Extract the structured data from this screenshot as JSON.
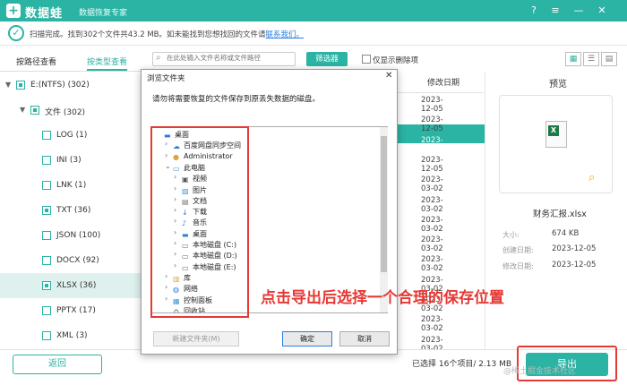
{
  "titlebar": {
    "logo_glyph": "+",
    "app_name": "数据蛙",
    "subtitle": "数据恢复专家",
    "icons": [
      "question-icon",
      "settings-icon",
      "minimize-icon",
      "close-icon"
    ]
  },
  "status": {
    "message": "扫描完成。找到302个文件共43.2 MB。如未能找到您想找回的文件请",
    "link": "联系我们。"
  },
  "tabs": {
    "by_path": "按路径查看",
    "by_type": "按类型查看"
  },
  "tree": [
    {
      "label": "E:(NTFS) (302)",
      "arrow": "▼",
      "state": "partial",
      "level": 0
    },
    {
      "label": "文件 (302)",
      "arrow": "▼",
      "state": "partial",
      "level": 1
    },
    {
      "label": "LOG (1)",
      "state": "empty",
      "level": 2
    },
    {
      "label": "INI (3)",
      "state": "empty",
      "level": 2
    },
    {
      "label": "LNK (1)",
      "state": "empty",
      "level": 2
    },
    {
      "label": "TXT (36)",
      "state": "partial",
      "level": 2
    },
    {
      "label": "JSON (100)",
      "state": "empty",
      "level": 2
    },
    {
      "label": "DOCX (92)",
      "state": "empty",
      "level": 2
    },
    {
      "label": "XLSX (36)",
      "state": "partial",
      "level": 2,
      "selected": true
    },
    {
      "label": "PPTX (17)",
      "state": "empty",
      "level": 2
    },
    {
      "label": "XML (3)",
      "state": "empty",
      "level": 2
    }
  ],
  "toolbar": {
    "search_placeholder": "在此处输入文件名称或文件路径",
    "filter": "筛选器",
    "only_deleted": "仅显示删除项"
  },
  "list": {
    "col_date": "修改日期",
    "dates": [
      "2023-12-05",
      "2023-12-05",
      "2023-12-05",
      "2023-12-05",
      "2023-03-02",
      "2023-03-02",
      "2023-03-02",
      "2023-03-02",
      "2023-03-02",
      "2023-03-02",
      "2023-03-02",
      "2023-03-02",
      "2023-03-02",
      "2023-03-27"
    ]
  },
  "preview": {
    "title": "预览",
    "filename": "财务汇报.xlsx",
    "size_label": "大小:",
    "size": "674 KB",
    "created_label": "创建日期:",
    "created": "2023-12-05",
    "modified_label": "修改日期:",
    "modified": "2023-12-05"
  },
  "bottom": {
    "back": "返回",
    "selected": "已选择 16个项目/ 2.13 MB",
    "export": "导出"
  },
  "dialog": {
    "title": "浏览文件夹",
    "message": "请勿将需要恢复的文件保存到原丢失数据的磁盘。",
    "nodes": [
      {
        "label": "桌面",
        "level": 0,
        "arrow": "",
        "icon": "desktop-icon"
      },
      {
        "label": "百度网盘同步空间",
        "level": 1,
        "arrow": "›",
        "icon": "cloud-folder-icon"
      },
      {
        "label": "Administrator",
        "level": 1,
        "arrow": "›",
        "icon": "user-icon"
      },
      {
        "label": "此电脑",
        "level": 1,
        "arrow": "⌄",
        "icon": "computer-icon"
      },
      {
        "label": "视频",
        "level": 2,
        "arrow": "›",
        "icon": "video-icon"
      },
      {
        "label": "图片",
        "level": 2,
        "arrow": "›",
        "icon": "picture-icon"
      },
      {
        "label": "文档",
        "level": 2,
        "arrow": "›",
        "icon": "document-icon"
      },
      {
        "label": "下载",
        "level": 2,
        "arrow": "›",
        "icon": "download-icon"
      },
      {
        "label": "音乐",
        "level": 2,
        "arrow": "›",
        "icon": "music-icon"
      },
      {
        "label": "桌面",
        "level": 2,
        "arrow": "›",
        "icon": "desktop-icon"
      },
      {
        "label": "本地磁盘 (C:)",
        "level": 2,
        "arrow": "›",
        "icon": "drive-icon"
      },
      {
        "label": "本地磁盘 (D:)",
        "level": 2,
        "arrow": "›",
        "icon": "drive-icon"
      },
      {
        "label": "本地磁盘 (E:)",
        "level": 2,
        "arrow": "›",
        "icon": "drive-icon"
      },
      {
        "label": "库",
        "level": 1,
        "arrow": "›",
        "icon": "library-icon"
      },
      {
        "label": "网络",
        "level": 1,
        "arrow": "›",
        "icon": "network-icon"
      },
      {
        "label": "控制面板",
        "level": 1,
        "arrow": "›",
        "icon": "control-panel-icon"
      },
      {
        "label": "回收站",
        "level": 1,
        "arrow": "",
        "icon": "recycle-bin-icon"
      }
    ],
    "new_folder": "新建文件夹(M)",
    "ok": "确定",
    "cancel": "取消"
  },
  "annotation": "点击导出后选择一个合理的保存位置",
  "watermark": "@稀土掘金技术社区",
  "colors": {
    "brand": "#2bb3a3",
    "annotation_red": "#e53935"
  }
}
